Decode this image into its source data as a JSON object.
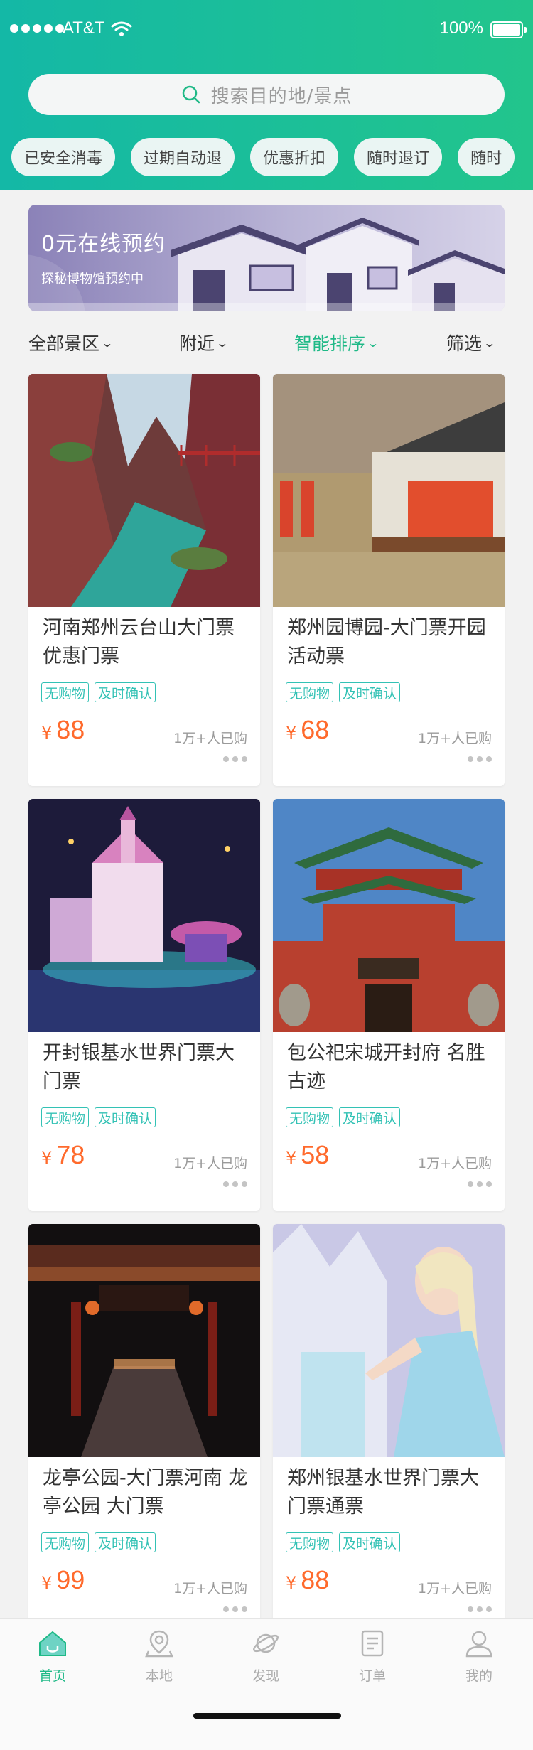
{
  "status_bar": {
    "carrier": "AT&T",
    "battery": "100%",
    "battery_level": 1.0
  },
  "search": {
    "placeholder": "搜索目的地/景点",
    "icon": "search-icon"
  },
  "tags": [
    "已安全消毒",
    "过期自动退",
    "优惠折扣",
    "随时退订",
    "随时"
  ],
  "banner": {
    "title": "0元在线预约",
    "subtitle": "探秘博物馆预约中"
  },
  "filters": {
    "area": "全部景区",
    "nearby": "附近",
    "sort": "智能排序",
    "filter": "筛选"
  },
  "cards": [
    {
      "title": "河南郑州云台山大门票 优惠门票",
      "badges": [
        "无购物",
        "及时确认"
      ],
      "price_symbol": "¥",
      "price": "88",
      "sold": "1万+人已购"
    },
    {
      "title": "郑州园博园-大门票开园活动票",
      "badges": [
        "无购物",
        "及时确认"
      ],
      "price_symbol": "¥",
      "price": "68",
      "sold": "1万+人已购"
    },
    {
      "title": "开封银基水世界门票大门票",
      "badges": [
        "无购物",
        "及时确认"
      ],
      "price_symbol": "¥",
      "price": "78",
      "sold": "1万+人已购"
    },
    {
      "title": "包公祀宋城开封府 名胜古迹",
      "badges": [
        "无购物",
        "及时确认"
      ],
      "price_symbol": "¥",
      "price": "58",
      "sold": "1万+人已购"
    },
    {
      "title": "龙亭公园-大门票河南 龙亭公园 大门票",
      "badges": [
        "无购物",
        "及时确认"
      ],
      "price_symbol": "¥",
      "price": "99",
      "sold": "1万+人已购"
    },
    {
      "title": "郑州银基水世界门票大门票通票",
      "badges": [
        "无购物",
        "及时确认"
      ],
      "price_symbol": "¥",
      "price": "88",
      "sold": "1万+人已购"
    }
  ],
  "tabbar": [
    {
      "label": "首页",
      "icon": "home-icon",
      "active": true
    },
    {
      "label": "本地",
      "icon": "location-icon",
      "active": false
    },
    {
      "label": "发现",
      "icon": "planet-icon",
      "active": false
    },
    {
      "label": "订单",
      "icon": "order-icon",
      "active": false
    },
    {
      "label": "我的",
      "icon": "profile-icon",
      "active": false
    }
  ],
  "colors": {
    "primary": "#1fb987",
    "header_start": "#14b8a6",
    "price": "#ff6a2c",
    "badge": "#33c2b5"
  }
}
